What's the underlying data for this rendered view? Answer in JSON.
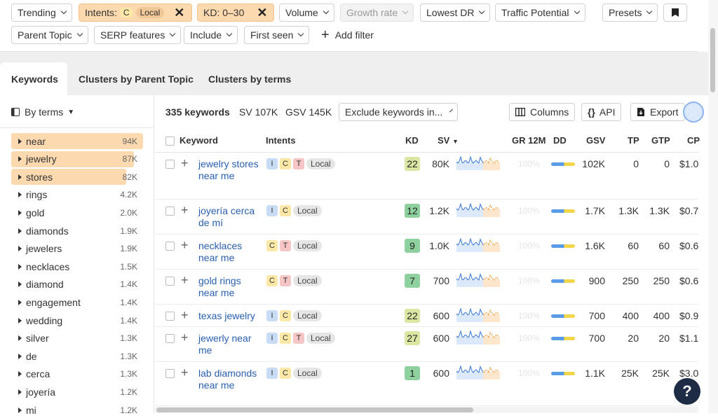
{
  "filters": {
    "trending": "Trending",
    "intents_label": "Intents:",
    "intents_c": "C",
    "intents_local": "Local",
    "kd": "KD: 0–30",
    "volume": "Volume",
    "growth_rate": "Growth rate",
    "lowest_dr": "Lowest DR",
    "traffic_potential": "Traffic Potential",
    "presets": "Presets",
    "parent_topic": "Parent Topic",
    "serp_features": "SERP features",
    "include": "Include",
    "first_seen": "First seen",
    "add_filter": "Add filter"
  },
  "tabs": [
    "Keywords",
    "Clusters by Parent Topic",
    "Clusters by terms"
  ],
  "sidebar": {
    "by_terms": "By terms",
    "items": [
      {
        "term": "near",
        "count": "94K",
        "fill": 1.0
      },
      {
        "term": "jewelry",
        "count": "87K",
        "fill": 0.93
      },
      {
        "term": "stores",
        "count": "82K",
        "fill": 0.87
      },
      {
        "term": "rings",
        "count": "4.2K",
        "fill": 0
      },
      {
        "term": "gold",
        "count": "2.0K",
        "fill": 0
      },
      {
        "term": "diamonds",
        "count": "1.9K",
        "fill": 0
      },
      {
        "term": "jewelers",
        "count": "1.9K",
        "fill": 0
      },
      {
        "term": "necklaces",
        "count": "1.5K",
        "fill": 0
      },
      {
        "term": "diamond",
        "count": "1.4K",
        "fill": 0
      },
      {
        "term": "engagement",
        "count": "1.4K",
        "fill": 0
      },
      {
        "term": "wedding",
        "count": "1.4K",
        "fill": 0
      },
      {
        "term": "silver",
        "count": "1.3K",
        "fill": 0
      },
      {
        "term": "de",
        "count": "1.3K",
        "fill": 0
      },
      {
        "term": "cerca",
        "count": "1.3K",
        "fill": 0
      },
      {
        "term": "joyería",
        "count": "1.2K",
        "fill": 0
      },
      {
        "term": "mi",
        "count": "1.2K",
        "fill": 0
      }
    ]
  },
  "summary": {
    "keywords": "335 keywords",
    "sv": "SV 107K",
    "gsv": "GSV 145K",
    "exclude": "Exclude keywords in...",
    "columns": "Columns",
    "api": "API",
    "export": "Export"
  },
  "table": {
    "headers": {
      "keyword": "Keyword",
      "intents": "Intents",
      "kd": "KD",
      "sv": "SV",
      "gr": "GR 12M",
      "dd": "DD",
      "gsv": "GSV",
      "tp": "TP",
      "gtp": "GTP",
      "cpc": "CP"
    },
    "rows": [
      {
        "kw": "jewelry stores near me",
        "intents": [
          "I",
          "C",
          "T"
        ],
        "local": "Local",
        "kd": "22",
        "sv": "80K",
        "gr": "100%",
        "gsv": "102K",
        "tp": "0",
        "gtp": "0",
        "cpc": "$1.0"
      },
      {
        "kw": "joyería cerca de mí",
        "intents": [
          "I",
          "C"
        ],
        "local": "Local",
        "kd": "12",
        "sv": "1.2K",
        "gr": "100%",
        "gsv": "1.7K",
        "tp": "1.3K",
        "gtp": "1.3K",
        "cpc": "$0.7"
      },
      {
        "kw": "necklaces near me",
        "intents": [
          "C",
          "T"
        ],
        "local": "Local",
        "kd": "9",
        "sv": "1.0K",
        "gr": "100%",
        "gsv": "1.6K",
        "tp": "60",
        "gtp": "60",
        "cpc": "$0.6"
      },
      {
        "kw": "gold rings near me",
        "intents": [
          "C",
          "T"
        ],
        "local": "Local",
        "kd": "7",
        "sv": "700",
        "gr": "100%",
        "gsv": "900",
        "tp": "250",
        "gtp": "250",
        "cpc": "$0.6"
      },
      {
        "kw": "texas jewelry",
        "intents": [
          "I",
          "C"
        ],
        "local": "Local",
        "kd": "22",
        "sv": "600",
        "gr": "100%",
        "gsv": "700",
        "tp": "400",
        "gtp": "400",
        "cpc": "$0.9"
      },
      {
        "kw": "jewerly near me",
        "intents": [
          "I",
          "C",
          "T"
        ],
        "local": "Local",
        "kd": "27",
        "sv": "600",
        "gr": "100%",
        "gsv": "700",
        "tp": "20",
        "gtp": "20",
        "cpc": "$1.1"
      },
      {
        "kw": "lab diamonds near me",
        "intents": [
          "I",
          "C"
        ],
        "local": "Local",
        "kd": "1",
        "sv": "600",
        "gr": "100%",
        "gsv": "1.1K",
        "tp": "25K",
        "gtp": "25K",
        "cpc": "$3.0"
      }
    ]
  },
  "colors": {
    "kd_easy": "#8fd19e",
    "kd_medium": "#dbe6a3",
    "accent": "#fdd9b0"
  },
  "help": "?"
}
